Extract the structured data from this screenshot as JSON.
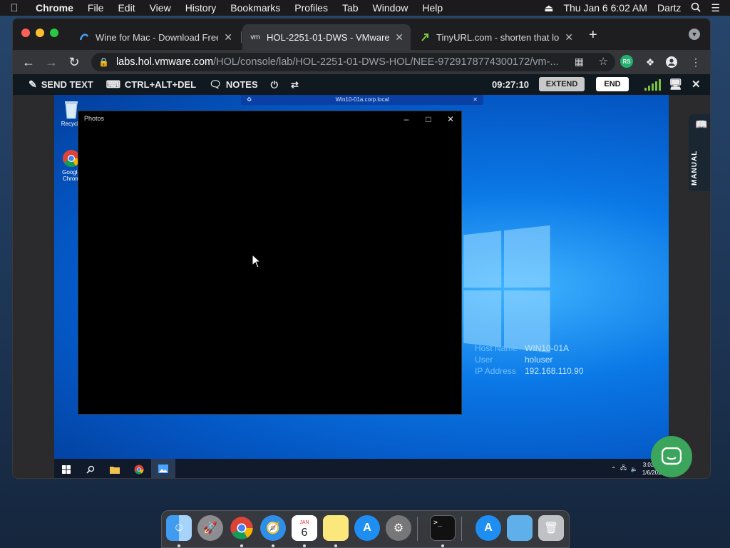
{
  "menubar": {
    "app": "Chrome",
    "items": [
      "File",
      "Edit",
      "View",
      "History",
      "Bookmarks",
      "Profiles",
      "Tab",
      "Window",
      "Help"
    ],
    "datetime": "Thu Jan 6  6:02 AM",
    "user": "Dartz"
  },
  "tabs": [
    {
      "title": "Wine for Mac - Download Free",
      "favicon": "wine-icon"
    },
    {
      "title": "HOL-2251-01-DWS - VMware",
      "favicon": "vm",
      "active": true
    },
    {
      "title": "TinyURL.com - shorten that lo",
      "favicon": "tinyurl-icon"
    }
  ],
  "address": {
    "host": "labs.hol.vmware.com",
    "path": "/HOL/console/lab/HOL-2251-01-DWS-HOL/NEE-9729178774300172/vm-..."
  },
  "extensions": {
    "profile_badge": "RS"
  },
  "hol_toolbar": {
    "send_text": "SEND TEXT",
    "ctrl_alt_del": "CTRL+ALT+DEL",
    "notes": "NOTES",
    "timer": "09:27:10",
    "extend": "EXTEND",
    "end": "END",
    "manual": "MANUAL"
  },
  "vm_bar": {
    "title": "Win10-01a.corp.local"
  },
  "windows_desktop": {
    "icons": [
      {
        "label": "Recycle",
        "icon": "recycle-bin-icon"
      },
      {
        "label": "Google Chrom",
        "icon": "chrome-icon"
      }
    ],
    "host_info": [
      {
        "label": "Host Name",
        "value": "WIN10-01A"
      },
      {
        "label": "User",
        "value": "holuser"
      },
      {
        "label": "IP Address",
        "value": "192.168.110.90"
      }
    ],
    "photos_window": {
      "title": "Photos"
    },
    "taskbar": {
      "time": "3:02 AM",
      "date": "1/6/2022"
    }
  },
  "dock": {
    "calendar_day": "JAN",
    "calendar_date": "6",
    "apps": [
      "finder-icon",
      "launchpad-icon",
      "chrome-icon",
      "safari-icon",
      "calendar-icon",
      "notes-icon",
      "app-store-icon",
      "system-preferences-icon",
      "terminal-icon",
      "applications-folder-icon",
      "downloads-folder-icon",
      "trash-icon"
    ]
  },
  "colors": {
    "accent_green": "#3ba55c",
    "signal": "#7ac142",
    "win_blue": "#0a78e6"
  }
}
